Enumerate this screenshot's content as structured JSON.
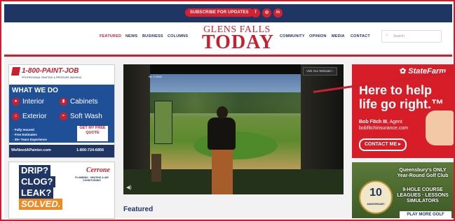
{
  "header": {
    "subscribe_label": "SUBSCRIBE FOR UPDATES",
    "social": [
      {
        "icon": "facebook-icon",
        "glyph": "f"
      },
      {
        "icon": "instagram-icon",
        "glyph": "◎"
      },
      {
        "icon": "linkedin-icon",
        "glyph": "in"
      }
    ]
  },
  "nav": {
    "left": [
      "FEATURED",
      "NEWS",
      "BUSINESS",
      "COLUMNS"
    ],
    "right": [
      "COMMUNITY",
      "OPINION",
      "MEDIA",
      "CONTACT"
    ],
    "active": "FEATURED"
  },
  "logo": {
    "line1": "GLENS FALLS",
    "line2": "TODAY"
  },
  "search": {
    "placeholder": "Search",
    "icon": "search-icon"
  },
  "colors": {
    "brand_red": "#c8202f",
    "brand_navy": "#1f3564",
    "statefarm_red": "#d71e28"
  },
  "ad_paint": {
    "phone": "1-800-PAINT-JOB",
    "tagline": "PROFESSIONAL PAINTING & PRESSURE WASHING",
    "heading": "WHAT WE DO",
    "services": [
      "Interior",
      "Cabinets",
      "Exterior",
      "Soft Wash"
    ],
    "bullets": [
      "· Fully Insured",
      "· Free Estimates",
      "· 25+ Years Experience"
    ],
    "quote": "GET MY FREE QUOTE",
    "website": "WeNeedAPainter.com",
    "footer_phone": "1-800-724-6856"
  },
  "ad_plumbing": {
    "lines": [
      "DRIP?",
      "CLOG?",
      "LEAK?"
    ],
    "solved": "SOLVED.",
    "brand": "Cerrone",
    "brand_sub": "PLUMBING · HEATING & AIR CONDITIONING"
  },
  "video": {
    "visit_label": "Visit Our Website! ›",
    "volume_icon": "volume-icon",
    "overlay_text": "No. 1 HOLE"
  },
  "section_title": "Featured",
  "ad_statefarm": {
    "logo": "StateFarm",
    "headline_line1": "Here to help",
    "headline_line2": "life go right.™",
    "agent_name": "Bob Fitch III",
    "agent_title": ", Agent",
    "agent_url": "bobfitchinsurance.com",
    "cta": "CONTACT ME ▸"
  },
  "ad_golf": {
    "line1": "Queensbury's ONLY",
    "line2": "Year-Round Golf Club",
    "line3": "9-HOLE COURSE",
    "line4": "LEAGUES · LESSONS",
    "line5": "SIMULATORS",
    "seal_number": "10",
    "seal_text": "ANNIVERSARY",
    "cta": "PLAY MORE GOLF"
  }
}
